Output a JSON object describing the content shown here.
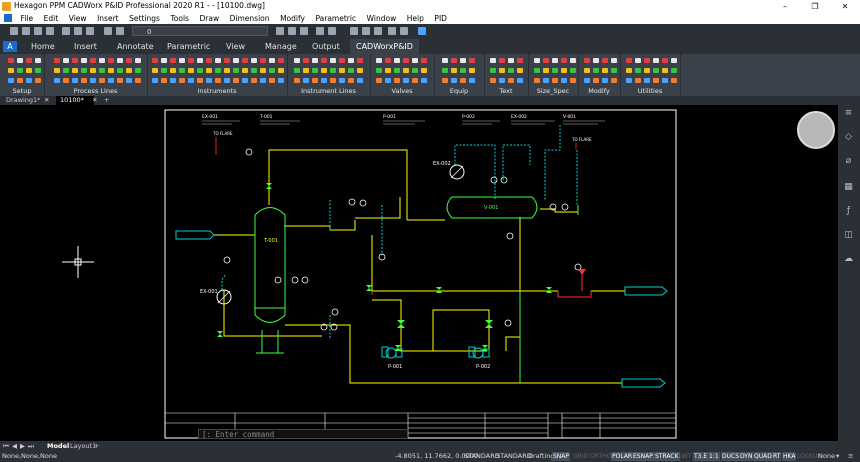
{
  "window": {
    "title": "Hexagon PPM CADWorx P&ID Professional 2020 R1 - - [10100.dwg]",
    "min": "–",
    "max": "❐",
    "close": "✕"
  },
  "menu": [
    "File",
    "Edit",
    "View",
    "Insert",
    "Settings",
    "Tools",
    "Draw",
    "Dimension",
    "Modify",
    "Parametric",
    "Window",
    "Help",
    "PID"
  ],
  "qat": {
    "layer_value": "0"
  },
  "ribbon_tabs": [
    "Home",
    "Insert",
    "Annotate",
    "Parametric",
    "View",
    "Manage",
    "Output",
    "CADWorxP&ID"
  ],
  "ribbon_active": "CADWorxP&ID",
  "ribbon_groups": [
    "Setup",
    "Process Lines",
    "Instruments",
    "Instrument Lines",
    "Valves",
    "Equip",
    "Text",
    "Size_Spec",
    "Modify",
    "Utilities"
  ],
  "doc_tabs": [
    "Drawing1*",
    "10100*"
  ],
  "doc_close": "✕",
  "doc_add": "+",
  "layout_tabs": [
    "Model",
    "Layout1"
  ],
  "layout_add": "+",
  "command_placeholder": "[: Enter command",
  "drawing": {
    "equipment": {
      "tower": "T-001",
      "drum": "V-001",
      "exchanger1": "EX-001",
      "exchanger2": "EX-002",
      "pump1": "P-001",
      "pump2": "P-002"
    },
    "flare1": "TO FLARE",
    "flare2": "TO FLARE",
    "title_headers": [
      "EX-001",
      "T-001",
      "P-001",
      "P-002",
      "EX-002",
      "V-001"
    ]
  },
  "status": {
    "coords": "-4.8051, 11.7662, 0.0000",
    "text_style": "STANDARD",
    "dim_style": "STANDARD",
    "workspace": "Drafting",
    "toggles": [
      {
        "label": "SNAP",
        "on": true
      },
      {
        "label": "GRID",
        "on": false
      },
      {
        "label": "ORTHO",
        "on": false
      },
      {
        "label": "POLAR",
        "on": true
      },
      {
        "label": "ESNAP",
        "on": true
      },
      {
        "label": "STRACK",
        "on": true
      },
      {
        "label": "LWT",
        "on": false
      },
      {
        "label": "T3.E",
        "on": true
      },
      {
        "label": "1:1",
        "on": true
      },
      {
        "label": "DUCS",
        "on": true
      },
      {
        "label": "DYN",
        "on": true
      },
      {
        "label": "QUAD",
        "on": true
      },
      {
        "label": "RT",
        "on": true
      },
      {
        "label": "HKA",
        "on": true
      },
      {
        "label": "LOCKUI",
        "on": false
      }
    ],
    "annotation": "None",
    "left_text": "None,None,None"
  },
  "colors": {
    "accent": "#1b6cc9",
    "pipe_yellow": "#ffff00",
    "pipe_cyan": "#00d0d0",
    "pipe_red": "#ff3030",
    "equip_green": "#40ff40"
  }
}
